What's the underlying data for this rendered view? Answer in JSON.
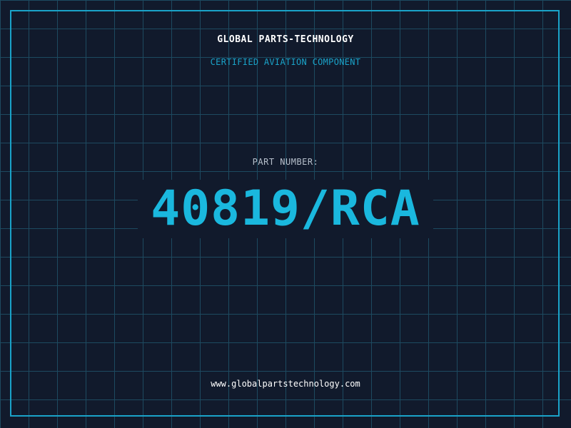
{
  "header": {
    "brand": "GLOBAL PARTS-TECHNOLOGY",
    "tagline": "CERTIFIED AVIATION COMPONENT"
  },
  "part": {
    "label": "PART NUMBER:",
    "number": "40819/RCA"
  },
  "footer": {
    "website": "www.globalpartstechnology.com"
  },
  "colors": {
    "background": "#111a2c",
    "grid": "#1d4a60",
    "accent": "#1aa3c9",
    "part_number": "#1ab8de",
    "brand_text": "#ffffff",
    "label_text": "#b7c0cc"
  }
}
